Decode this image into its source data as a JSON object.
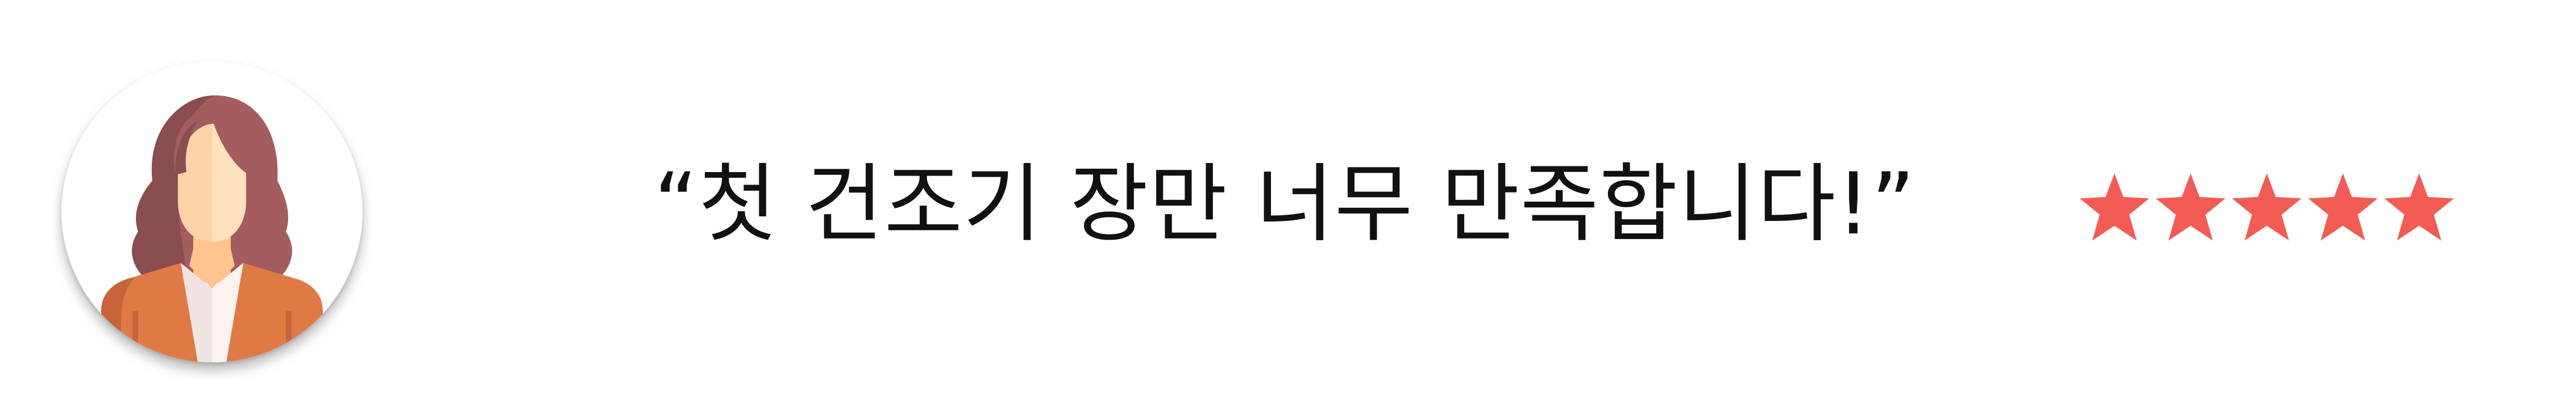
{
  "review": {
    "quote": "“첫 건조기 장만 너무 만족합니다!”",
    "rating": 5,
    "rating_max": 5,
    "star_color": "#f25c54",
    "avatar_icon": "woman-avatar-icon"
  },
  "colors": {
    "hair": "#a35d5f",
    "hair_shadow": "#8a4e51",
    "skin": "#ffd3a8",
    "skin_light": "#ffe1bd",
    "jacket": "#e07a45",
    "jacket_dark": "#c8643a",
    "shirt": "#f0e4e2"
  }
}
